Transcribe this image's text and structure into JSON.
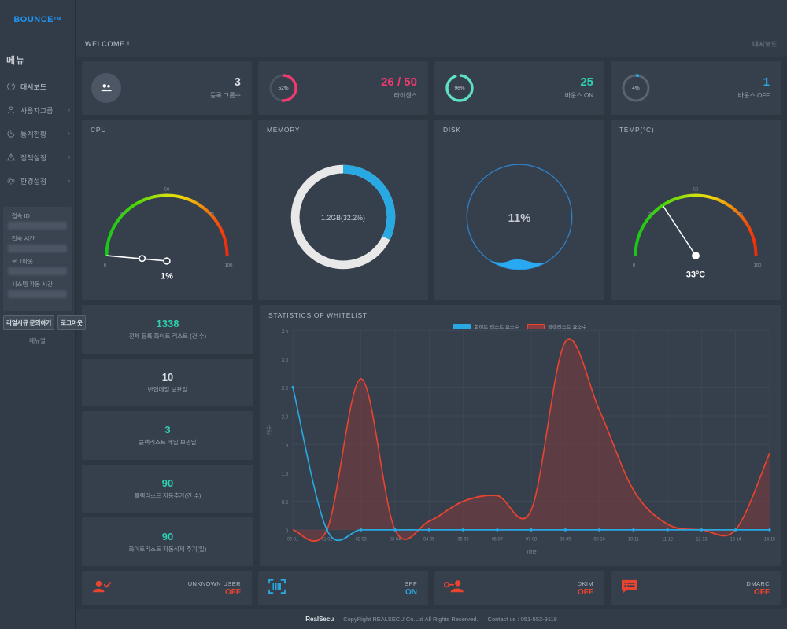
{
  "brand": {
    "name": "BOUNCE",
    "sup": "TM"
  },
  "sidebar": {
    "menu_title": "메뉴",
    "items": [
      {
        "label": "대시보드",
        "icon": "dashboard-icon",
        "arrow": "",
        "active": true
      },
      {
        "label": "사용자그룹",
        "icon": "user-group-icon",
        "arrow": "›",
        "active": false
      },
      {
        "label": "통계현황",
        "icon": "chart-clock-icon",
        "arrow": "›",
        "active": false
      },
      {
        "label": "정책설정",
        "icon": "warning-triangle-icon",
        "arrow": "›",
        "active": false
      },
      {
        "label": "환경설정",
        "icon": "gear-icon",
        "arrow": "›",
        "active": false
      }
    ],
    "info": [
      {
        "label": "· 접속 ID",
        "value": ""
      },
      {
        "label": "· 접속 시간",
        "value": ""
      },
      {
        "label": "· 로그아웃",
        "value": ""
      },
      {
        "label": "· 시스템 가동 시간",
        "value": ""
      }
    ],
    "contact_button": "리얼시큐 문의하기",
    "logout_button": "로그아웃",
    "manual_link": "메뉴얼"
  },
  "header": {
    "welcome": "WELCOME !",
    "breadcrumb": "대시보드"
  },
  "kpis": [
    {
      "name": "registered-groups",
      "value": "3",
      "label": "등록 그룹수",
      "value_color": "#d8dde4",
      "icon": "people-icon",
      "percent": null,
      "ring_color": ""
    },
    {
      "name": "license",
      "value": "26 / 50",
      "label": "라이센스",
      "value_color": "#ef3a70",
      "percent": "52%",
      "percent_num": 52,
      "ring_color": "#ef3a70"
    },
    {
      "name": "bounce-on",
      "value": "25",
      "label": "바운스 ON",
      "value_color": "#2ecfb0",
      "percent": "96%",
      "percent_num": 96,
      "ring_color": "#5fe0c3"
    },
    {
      "name": "bounce-off",
      "value": "1",
      "label": "바운스 OFF",
      "value_color": "#29a9e1",
      "percent": "4%",
      "percent_num": 4,
      "ring_color": "#29a9e1"
    }
  ],
  "gauges": {
    "cpu": {
      "title": "CPU",
      "value_text": "1%",
      "value_num": 1,
      "ticks": [
        "0",
        "25",
        "50",
        "75",
        "100"
      ]
    },
    "memory": {
      "title": "MEMORY",
      "center_text": "1.2GB(32.2%)",
      "percent_num": 32.2,
      "arc_color": "#29a9e1",
      "track_color": "#e8e8e8"
    },
    "disk": {
      "title": "DISK",
      "center_text": "11%",
      "percent_num": 11,
      "fill_color": "#29a9e1"
    },
    "temp": {
      "title": "TEMP(°C)",
      "value_text": "33°C",
      "value_num": 33,
      "ticks": [
        "0",
        "25",
        "50",
        "75",
        "100"
      ]
    }
  },
  "stats": [
    {
      "value": "1338",
      "label": "전체 등록 화이트 리스트 (건 수)"
    },
    {
      "value": "10",
      "label": "반입메일 보관일"
    },
    {
      "value": "3",
      "label": "블랙리스트 메일 보관일"
    },
    {
      "value": "90",
      "label": "블랙리스트 자동추가(건 수)"
    },
    {
      "value": "90",
      "label": "화이트리스트 자동삭제 주기(일)"
    }
  ],
  "chart_data": {
    "type": "area",
    "title": "STATISTICS OF WHITELIST",
    "xlabel": "Time",
    "ylabel": "개수",
    "ylim": [
      0,
      3.5
    ],
    "yticks": [
      "0",
      "0.5",
      "1.0",
      "1.5",
      "2.0",
      "2.5",
      "3.0",
      "3.5"
    ],
    "grid": true,
    "legend_position": "top-center",
    "categories": [
      "00-01",
      "01-02",
      "02-03",
      "03-04",
      "04-05",
      "05-06",
      "06-07",
      "07-08",
      "08-09",
      "09-10",
      "10-11",
      "11-12",
      "12-13",
      "13-14",
      "14-15"
    ],
    "series": [
      {
        "name": "화이트 리스트 요소수",
        "color": "#29a9e1",
        "values": [
          2.5,
          0,
          0,
          0,
          0,
          0,
          0,
          0,
          0,
          0,
          0,
          0,
          0,
          0,
          0
        ]
      },
      {
        "name": "블랙리스트 요소수",
        "color": "#e8442f",
        "values": [
          0,
          0,
          2.65,
          0,
          0.15,
          0.5,
          0.6,
          0.35,
          3.3,
          2.1,
          0.7,
          0.1,
          0,
          0,
          1.35
        ]
      }
    ]
  },
  "statuses": [
    {
      "name": "UNKNOWN USER",
      "state": "OFF",
      "state_type": "off",
      "icon": "user-check-icon",
      "icon_color": "#e8442f"
    },
    {
      "name": "SPF",
      "state": "ON",
      "state_type": "on",
      "icon": "barcode-scan-icon",
      "icon_color": "#29a9e1"
    },
    {
      "name": "DKIM",
      "state": "OFF",
      "state_type": "off",
      "icon": "user-key-icon",
      "icon_color": "#e8442f"
    },
    {
      "name": "DMARC",
      "state": "OFF",
      "state_type": "off",
      "icon": "message-list-icon",
      "icon_color": "#e8442f"
    }
  ],
  "footer": {
    "logo": "RealSecu",
    "copyright": "CopyRight REALSECU Co.Ltd All Rights Reserved.",
    "contact": "Contact us : 051-552-9118"
  }
}
